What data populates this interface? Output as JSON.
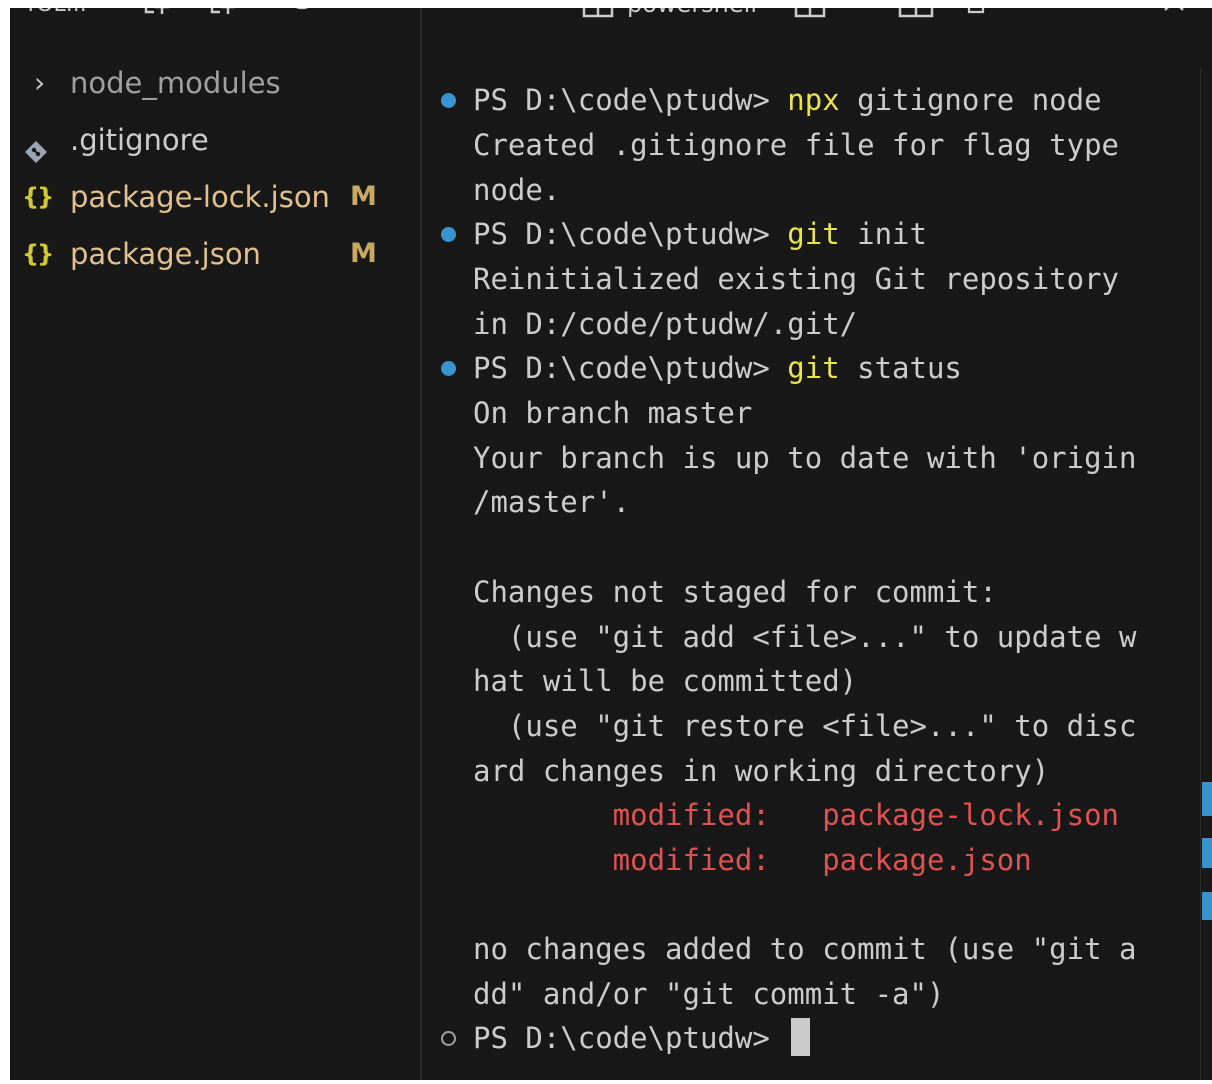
{
  "explorer": {
    "header_title": "YOL...",
    "items": [
      {
        "name": "node_modules",
        "kind": "folder",
        "badge": "",
        "color": "#a0a0a0",
        "icon": "chevron-right-icon"
      },
      {
        "name": ".gitignore",
        "kind": "git",
        "badge": "",
        "color": "#cccccc",
        "icon": "git-diamond-icon"
      },
      {
        "name": "package-lock.json",
        "kind": "json",
        "badge": "M",
        "color": "#e2c08d",
        "icon": "json-braces-icon"
      },
      {
        "name": "package.json",
        "kind": "json",
        "badge": "M",
        "color": "#e2c08d",
        "icon": "json-braces-icon"
      }
    ],
    "header_icons": [
      "new-file-icon",
      "new-folder-icon",
      "refresh-icon",
      "collapse-all-icon"
    ]
  },
  "terminal": {
    "tab_label": "powershell",
    "json_glyph": "{}",
    "cursor_icon": "block-cursor-icon",
    "toolbar_icons": [
      "terminal-icon",
      "split-terminal-icon",
      "dropdown-icon",
      "split-icon",
      "trash-icon",
      "chevron-down-icon",
      "close-icon"
    ],
    "colors": {
      "prompt_dot": "#3794d1",
      "command": "#ebe34b",
      "modified": "#e05252",
      "text": "#cccccc",
      "background": "#181818"
    },
    "lines": {
      "l1_prompt": "PS D:\\code\\ptudw> ",
      "l1_cmd": "npx",
      "l1_rest": " gitignore node",
      "l2": "Created .gitignore file for flag type",
      "l3": "node.",
      "l4_prompt": "PS D:\\code\\ptudw> ",
      "l4_cmd": "git",
      "l4_rest": " init",
      "l5": "Reinitialized existing Git repository",
      "l6": "in D:/code/ptudw/.git/",
      "l7_prompt": "PS D:\\code\\ptudw> ",
      "l7_cmd": "git",
      "l7_rest": " status",
      "l8": "On branch master",
      "l9": "Your branch is up to date with 'origin",
      "l10": "/master'.",
      "l12": "Changes not staged for commit:",
      "l13": "  (use \"git add <file>...\" to update w",
      "l14": "hat will be committed)",
      "l15": "  (use \"git restore <file>...\" to disc",
      "l16": "ard changes in working directory)",
      "l17_label": "        modified:   ",
      "l17_file": "package-lock.json",
      "l18_label": "        modified:   ",
      "l18_file": "package.json",
      "l20": "no changes added to commit (use \"git a",
      "l21": "dd\" and/or \"git commit -a\")",
      "l22_prompt": "PS D:\\code\\ptudw> "
    }
  }
}
